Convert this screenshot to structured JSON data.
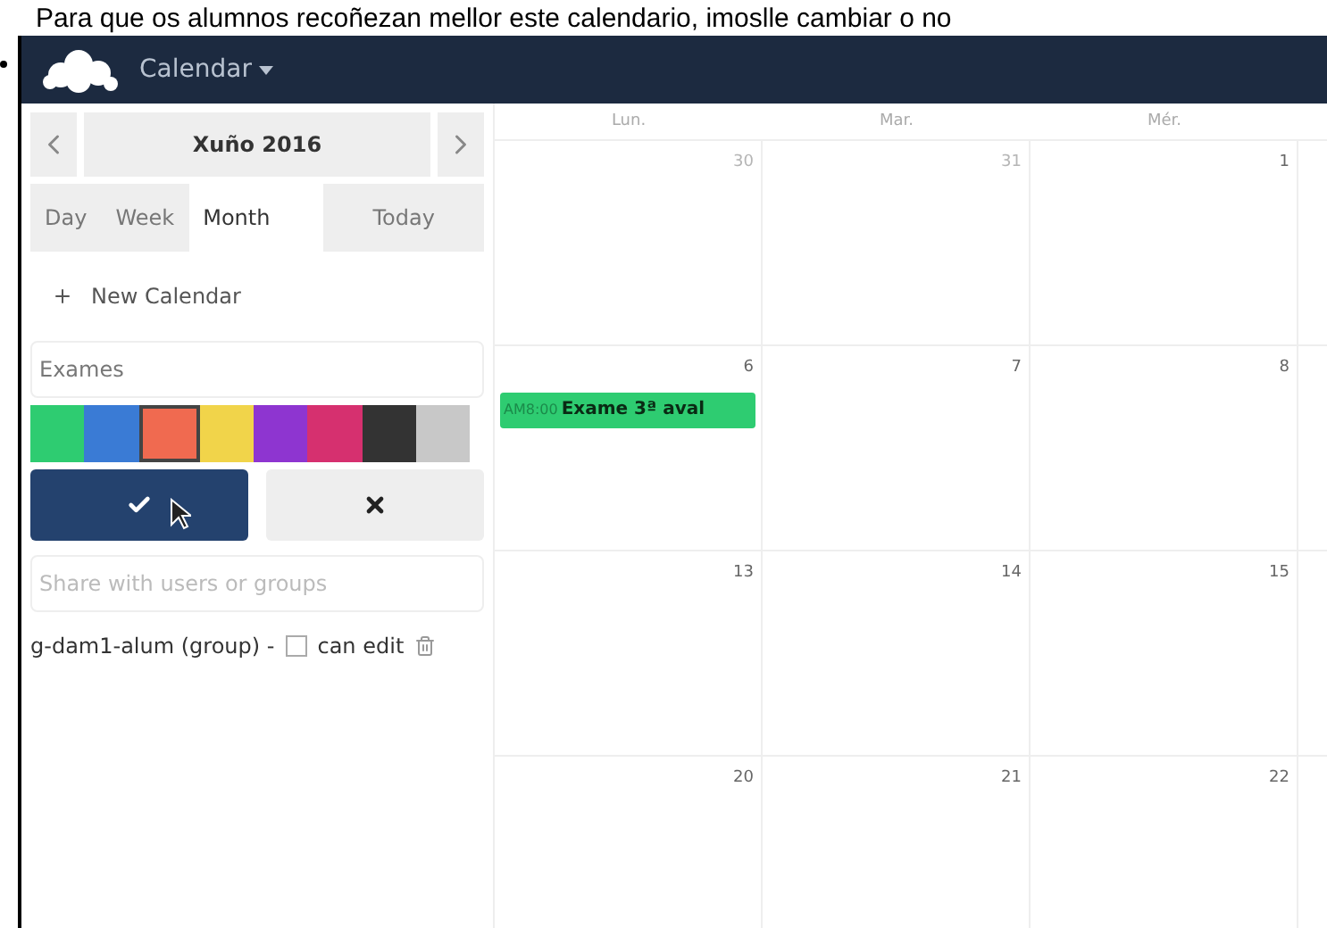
{
  "caption": "Para que os alumnos recoñezan mellor este calendario, imoslle cambiar o no",
  "header": {
    "app_title": "Calendar"
  },
  "sidebar": {
    "month_label": "Xuño 2016",
    "views": [
      {
        "label": "Day",
        "selected": false
      },
      {
        "label": "Week",
        "selected": false
      },
      {
        "label": "Month",
        "selected": true
      }
    ],
    "today_button": "Today",
    "new_calendar": "New Calendar",
    "calendar_name": "Exames",
    "colors": [
      {
        "color": "#2ecc71",
        "selected": false
      },
      {
        "color": "#3a7bd5",
        "selected": false
      },
      {
        "color": "#f06a50",
        "selected": true
      },
      {
        "color": "#f1d44a",
        "selected": false
      },
      {
        "color": "#8e35d0",
        "selected": false
      },
      {
        "color": "#d6306f",
        "selected": false
      },
      {
        "color": "#333333",
        "selected": false
      },
      {
        "color": "#c8c8c8",
        "selected": false
      }
    ],
    "share_placeholder": "Share with users or groups",
    "shares": [
      {
        "name": "g-dam1-alum (group) -",
        "can_edit": false,
        "can_edit_label": "can edit"
      }
    ]
  },
  "calendar": {
    "weekdays": [
      "Lun.",
      "Mar.",
      "Mér."
    ],
    "weeks": [
      [
        {
          "day": "30",
          "other_month": true
        },
        {
          "day": "31",
          "other_month": true
        },
        {
          "day": "1",
          "other_month": false
        }
      ],
      [
        {
          "day": "6",
          "other_month": false,
          "events": [
            {
              "time": "AM8:00",
              "title": "Exame 3ª aval",
              "color": "#2ecc71"
            }
          ]
        },
        {
          "day": "7",
          "other_month": false
        },
        {
          "day": "8",
          "other_month": false
        }
      ],
      [
        {
          "day": "13",
          "other_month": false
        },
        {
          "day": "14",
          "other_month": false
        },
        {
          "day": "15",
          "other_month": false
        }
      ],
      [
        {
          "day": "20",
          "other_month": false
        },
        {
          "day": "21",
          "other_month": false
        },
        {
          "day": "22",
          "other_month": false
        }
      ]
    ]
  }
}
